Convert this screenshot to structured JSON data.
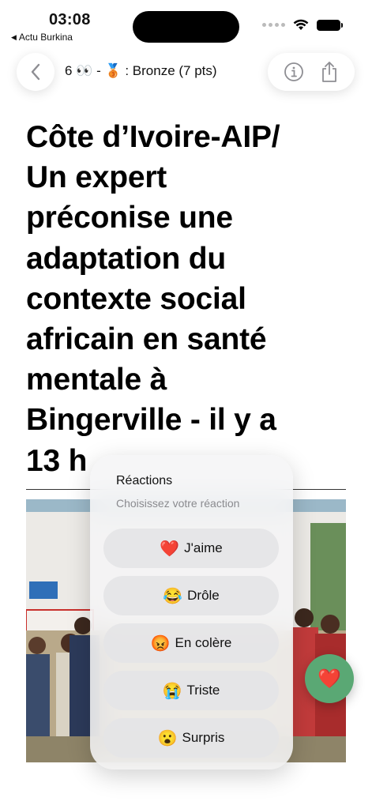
{
  "status_bar": {
    "time": "03:08",
    "back_app": "Actu Burkina"
  },
  "nav": {
    "title": "6 👀 - 🥉 : Bronze (7 pts)",
    "back_icon": "chevron-left-icon",
    "info_icon": "info-icon",
    "share_icon": "share-icon"
  },
  "article": {
    "headline_lines": [
      "Côte d’Ivoire-AIP/",
      "Un expert",
      "préconise une",
      "adaptation du",
      "contexte social",
      "africain en santé",
      "mentale à",
      "Bingerville - il y a",
      "13 h"
    ]
  },
  "reactions": {
    "title": "Réactions",
    "subtitle": "Choisissez votre réaction",
    "options": [
      {
        "emoji": "❤️",
        "label": "J'aime"
      },
      {
        "emoji": "😂",
        "label": "Drôle"
      },
      {
        "emoji": "😡",
        "label": "En colère"
      },
      {
        "emoji": "😭",
        "label": "Triste"
      },
      {
        "emoji": "😮",
        "label": "Surpris"
      }
    ]
  },
  "fab": {
    "emoji": "❤️"
  },
  "colors": {
    "fab_green": "#5aa874",
    "sheet_bg": "#f4f4f6",
    "reaction_bg": "#e4e4e6"
  }
}
